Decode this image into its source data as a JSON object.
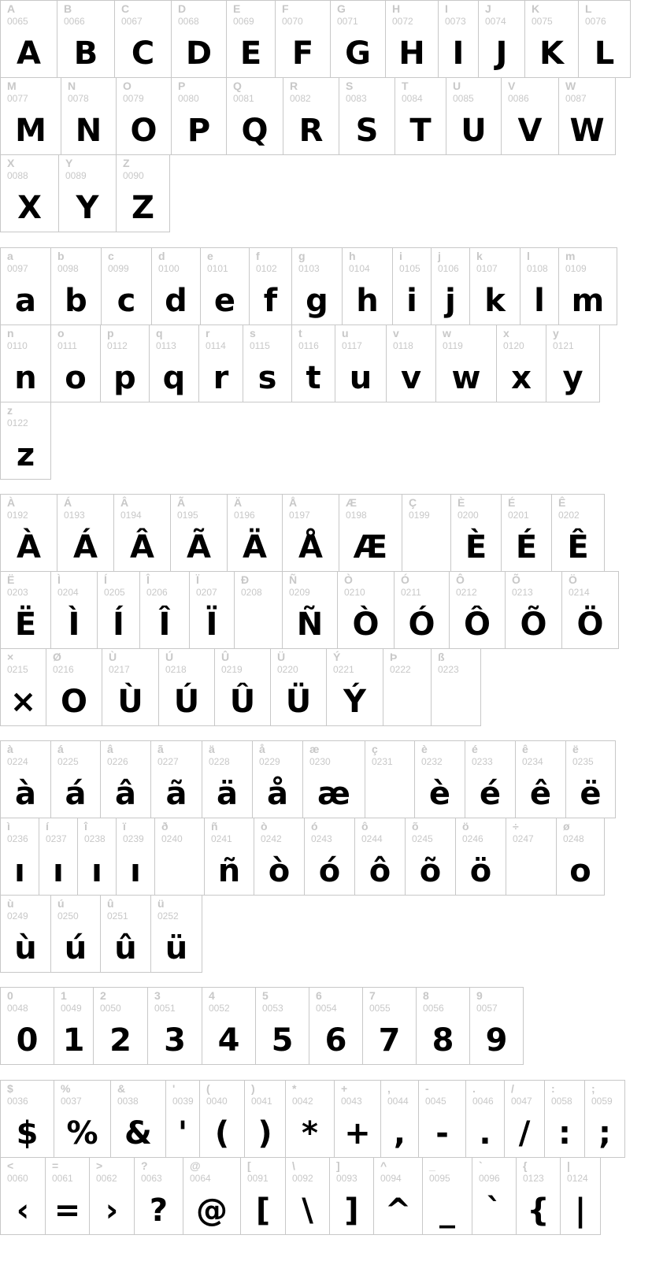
{
  "sections": [
    {
      "rows": [
        {
          "cells": [
            [
              "A",
              "0065",
              "A"
            ],
            [
              "B",
              "0066",
              "B"
            ],
            [
              "C",
              "0067",
              "C"
            ],
            [
              "D",
              "0068",
              "D"
            ],
            [
              "E",
              "0069",
              "E"
            ],
            [
              "F",
              "0070",
              "F"
            ],
            [
              "G",
              "0071",
              "G"
            ],
            [
              "H",
              "0072",
              "H"
            ],
            [
              "I",
              "0073",
              "I"
            ],
            [
              "J",
              "0074",
              "J"
            ],
            [
              "K",
              "0075",
              "K"
            ],
            [
              "L",
              "0076",
              "L"
            ]
          ]
        },
        {
          "cells": [
            [
              "M",
              "0077",
              "M"
            ],
            [
              "N",
              "0078",
              "N"
            ],
            [
              "O",
              "0079",
              "O"
            ],
            [
              "P",
              "0080",
              "P"
            ],
            [
              "Q",
              "0081",
              "Q"
            ],
            [
              "R",
              "0082",
              "R"
            ],
            [
              "S",
              "0083",
              "S"
            ],
            [
              "T",
              "0084",
              "T"
            ],
            [
              "U",
              "0085",
              "U"
            ],
            [
              "V",
              "0086",
              "V"
            ],
            [
              "W",
              "0087",
              "W"
            ]
          ]
        },
        {
          "cells": [
            [
              "X",
              "0088",
              "X"
            ],
            [
              "Y",
              "0089",
              "Y"
            ],
            [
              "Z",
              "0090",
              "Z"
            ]
          ]
        }
      ]
    },
    {
      "rows": [
        {
          "cells": [
            [
              "a",
              "0097",
              "a"
            ],
            [
              "b",
              "0098",
              "b"
            ],
            [
              "c",
              "0099",
              "c"
            ],
            [
              "d",
              "0100",
              "d"
            ],
            [
              "e",
              "0101",
              "e"
            ],
            [
              "f",
              "0102",
              "f"
            ],
            [
              "g",
              "0103",
              "g"
            ],
            [
              "h",
              "0104",
              "h"
            ],
            [
              "i",
              "0105",
              "i"
            ],
            [
              "j",
              "0106",
              "j"
            ],
            [
              "k",
              "0107",
              "k"
            ],
            [
              "l",
              "0108",
              "l"
            ],
            [
              "m",
              "0109",
              "m"
            ]
          ]
        },
        {
          "cells": [
            [
              "n",
              "0110",
              "n"
            ],
            [
              "o",
              "0111",
              "o"
            ],
            [
              "p",
              "0112",
              "p"
            ],
            [
              "q",
              "0113",
              "q"
            ],
            [
              "r",
              "0114",
              "r"
            ],
            [
              "s",
              "0115",
              "s"
            ],
            [
              "t",
              "0116",
              "t"
            ],
            [
              "u",
              "0117",
              "u"
            ],
            [
              "v",
              "0118",
              "v"
            ],
            [
              "w",
              "0119",
              "w"
            ],
            [
              "x",
              "0120",
              "x"
            ],
            [
              "y",
              "0121",
              "y"
            ]
          ]
        },
        {
          "cells": [
            [
              "z",
              "0122",
              "z"
            ]
          ]
        }
      ]
    },
    {
      "rows": [
        {
          "cells": [
            [
              "À",
              "0192",
              "À"
            ],
            [
              "Á",
              "0193",
              "Á"
            ],
            [
              "Â",
              "0194",
              "Â"
            ],
            [
              "Ã",
              "0195",
              "Ã"
            ],
            [
              "Ä",
              "0196",
              "Ä"
            ],
            [
              "Å",
              "0197",
              "Å"
            ],
            [
              "Æ",
              "0198",
              "Æ"
            ],
            [
              "Ç",
              "0199",
              ""
            ],
            [
              "È",
              "0200",
              "È"
            ],
            [
              "É",
              "0201",
              "É"
            ],
            [
              "Ê",
              "0202",
              "Ê"
            ]
          ]
        },
        {
          "cells": [
            [
              "Ë",
              "0203",
              "Ë"
            ],
            [
              "Ì",
              "0204",
              "Ì"
            ],
            [
              "Í",
              "0205",
              "Í"
            ],
            [
              "Î",
              "0206",
              "Î"
            ],
            [
              "Ï",
              "0207",
              "Ï"
            ],
            [
              "Ð",
              "0208",
              ""
            ],
            [
              "Ñ",
              "0209",
              "Ñ"
            ],
            [
              "Ò",
              "0210",
              "Ò"
            ],
            [
              "Ó",
              "0211",
              "Ó"
            ],
            [
              "Ô",
              "0212",
              "Ô"
            ],
            [
              "Õ",
              "0213",
              "Õ"
            ],
            [
              "Ö",
              "0214",
              "Ö"
            ]
          ]
        },
        {
          "cells": [
            [
              "×",
              "0215",
              "×"
            ],
            [
              "Ø",
              "0216",
              "O"
            ],
            [
              "Ù",
              "0217",
              "Ù"
            ],
            [
              "Ú",
              "0218",
              "Ú"
            ],
            [
              "Û",
              "0219",
              "Û"
            ],
            [
              "Ü",
              "0220",
              "Ü"
            ],
            [
              "Ý",
              "0221",
              "Ý"
            ],
            [
              "Þ",
              "0222",
              ""
            ],
            [
              "ß",
              "0223",
              ""
            ]
          ]
        }
      ]
    },
    {
      "rows": [
        {
          "cells": [
            [
              "à",
              "0224",
              "à"
            ],
            [
              "á",
              "0225",
              "á"
            ],
            [
              "â",
              "0226",
              "â"
            ],
            [
              "ã",
              "0227",
              "ã"
            ],
            [
              "ä",
              "0228",
              "ä"
            ],
            [
              "å",
              "0229",
              "å"
            ],
            [
              "æ",
              "0230",
              "æ"
            ],
            [
              "ç",
              "0231",
              ""
            ],
            [
              "è",
              "0232",
              "è"
            ],
            [
              "é",
              "0233",
              "é"
            ],
            [
              "ê",
              "0234",
              "ê"
            ],
            [
              "ë",
              "0235",
              "ë"
            ]
          ]
        },
        {
          "cells": [
            [
              "ì",
              "0236",
              "ı"
            ],
            [
              "í",
              "0237",
              "ı"
            ],
            [
              "î",
              "0238",
              "ı"
            ],
            [
              "ï",
              "0239",
              "ı"
            ],
            [
              "ð",
              "0240",
              ""
            ],
            [
              "ñ",
              "0241",
              "ñ"
            ],
            [
              "ò",
              "0242",
              "ò"
            ],
            [
              "ó",
              "0243",
              "ó"
            ],
            [
              "ô",
              "0244",
              "ô"
            ],
            [
              "õ",
              "0245",
              "õ"
            ],
            [
              "ö",
              "0246",
              "ö"
            ],
            [
              "÷",
              "0247",
              ""
            ],
            [
              "ø",
              "0248",
              "o"
            ]
          ]
        },
        {
          "cells": [
            [
              "ù",
              "0249",
              "ù"
            ],
            [
              "ú",
              "0250",
              "ú"
            ],
            [
              "û",
              "0251",
              "û"
            ],
            [
              "ü",
              "0252",
              "ü"
            ]
          ]
        }
      ]
    },
    {
      "rows": [
        {
          "cells": [
            [
              "0",
              "0048",
              "0"
            ],
            [
              "1",
              "0049",
              "1"
            ],
            [
              "2",
              "0050",
              "2"
            ],
            [
              "3",
              "0051",
              "3"
            ],
            [
              "4",
              "0052",
              "4"
            ],
            [
              "5",
              "0053",
              "5"
            ],
            [
              "6",
              "0054",
              "6"
            ],
            [
              "7",
              "0055",
              "7"
            ],
            [
              "8",
              "0056",
              "8"
            ],
            [
              "9",
              "0057",
              "9"
            ]
          ]
        }
      ]
    },
    {
      "rows": [
        {
          "cells": [
            [
              "$",
              "0036",
              "$"
            ],
            [
              "%",
              "0037",
              "%"
            ],
            [
              "&",
              "0038",
              "&"
            ],
            [
              "'",
              "0039",
              "'"
            ],
            [
              "(",
              "0040",
              "("
            ],
            [
              ")",
              "0041",
              ")"
            ],
            [
              "*",
              "0042",
              "*"
            ],
            [
              "+",
              "0043",
              "+"
            ],
            [
              ",",
              "0044",
              ","
            ],
            [
              "-",
              "0045",
              "-"
            ],
            [
              ".",
              "0046",
              "."
            ],
            [
              "/",
              "0047",
              "/"
            ],
            [
              ":",
              "0058",
              ":"
            ],
            [
              ";",
              "0059",
              ";"
            ]
          ]
        },
        {
          "cells": [
            [
              "<",
              "0060",
              "‹"
            ],
            [
              "=",
              "0061",
              "="
            ],
            [
              ">",
              "0062",
              "›"
            ],
            [
              "?",
              "0063",
              "?"
            ],
            [
              "@",
              "0064",
              "@"
            ],
            [
              "[",
              "0091",
              "["
            ],
            [
              "\\",
              "0092",
              "\\"
            ],
            [
              "]",
              "0093",
              "]"
            ],
            [
              "^",
              "0094",
              "^"
            ],
            [
              "_",
              "0095",
              "_"
            ],
            [
              "`",
              "0096",
              "`"
            ],
            [
              "{",
              "0123",
              "{"
            ],
            [
              "|",
              "0124",
              "|"
            ]
          ]
        }
      ]
    }
  ]
}
